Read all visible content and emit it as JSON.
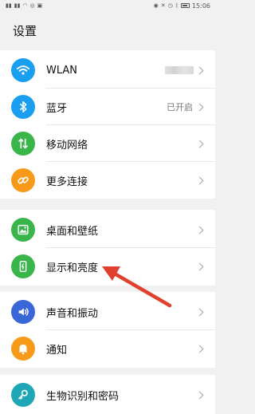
{
  "status_bar": {
    "time": "15:06",
    "left_icons": [
      "signal-icon",
      "signal-icon",
      "wifi-icon",
      "nfc-icon",
      "media-icon"
    ],
    "right_icons": [
      "eye-icon",
      "mute-icon",
      "alarm-icon",
      "bluetooth-icon",
      "battery-icon"
    ]
  },
  "page": {
    "title": "设置"
  },
  "groups": [
    {
      "items": [
        {
          "label": "WLAN",
          "icon": "wifi-icon",
          "color": "#1a9ef0",
          "value": ""
        },
        {
          "label": "蓝牙",
          "icon": "bluetooth-icon",
          "color": "#1a9ef0",
          "value": "已开启"
        },
        {
          "label": "移动网络",
          "icon": "mobile-data-icon",
          "color": "#39b54a",
          "value": ""
        },
        {
          "label": "更多连接",
          "icon": "link-icon",
          "color": "#f79a1a",
          "value": ""
        }
      ]
    },
    {
      "items": [
        {
          "label": "桌面和壁纸",
          "icon": "wallpaper-icon",
          "color": "#39b54a",
          "value": ""
        },
        {
          "label": "显示和亮度",
          "icon": "display-brightness-icon",
          "color": "#39b54a",
          "value": ""
        }
      ]
    },
    {
      "items": [
        {
          "label": "声音和振动",
          "icon": "sound-icon",
          "color": "#3a67d8",
          "value": ""
        },
        {
          "label": "通知",
          "icon": "bell-icon",
          "color": "#f79a1a",
          "value": ""
        }
      ]
    },
    {
      "items": [
        {
          "label": "生物识别和密码",
          "icon": "key-icon",
          "color": "#1fa7b8",
          "value": ""
        }
      ]
    }
  ],
  "annotation": {
    "color": "#e0412e"
  }
}
